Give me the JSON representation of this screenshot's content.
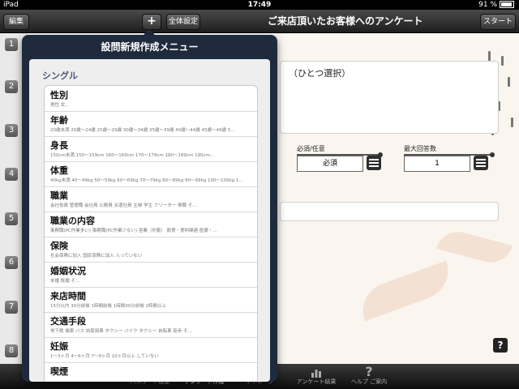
{
  "status": {
    "device": "iPad",
    "time": "17:49",
    "battery": "91 %"
  },
  "nav": {
    "edit": "編集",
    "plus": "+",
    "settings": "全体設定",
    "title": "ご来店頂いたお客様へのアンケート",
    "start": "スタート"
  },
  "questions": {
    "numbers": [
      "1",
      "2",
      "3",
      "4",
      "5",
      "6",
      "7",
      "8"
    ]
  },
  "detail": {
    "question_suffix": "（ひとつ選択）",
    "required_label": "必須/任意",
    "required_value": "必須",
    "max_label": "最大回答数",
    "max_value": "1"
  },
  "popover": {
    "title": "設問新規作成メニュー",
    "section": "シングル",
    "items": [
      {
        "title": "性別",
        "desc": "男性 女..."
      },
      {
        "title": "年齢",
        "desc": "20歳未満 20歳〜24歳 25歳〜29歳 30歳〜34歳 35歳〜39歳 40歳〜44歳 45歳〜49歳 5..."
      },
      {
        "title": "身長",
        "desc": "150cm未満 150〜159cm 160〜169cm 170〜179cm 180〜189cm 190cm..."
      },
      {
        "title": "体重",
        "desc": "40kg未満 40〜49kg 50〜59kg 60〜69kg 70〜79kg 80〜89kg 90〜99kg 100〜109kg 1..."
      },
      {
        "title": "職業",
        "desc": "会社役員 管理職 会社員 公務員 派遣社員 主婦 学生 フリーター 無職 そ..."
      },
      {
        "title": "職業の内容",
        "desc": "事務職(PC作業多い) 事務職(PC作業少ない) 営業（外勤） 飲食・食料関連 医療・..."
      },
      {
        "title": "保険",
        "desc": "社会保険に加入 国民保険に加入 入っていない"
      },
      {
        "title": "婚姻状況",
        "desc": "未婚 既婚 そ..."
      },
      {
        "title": "来店時間",
        "desc": "15分以内 30分前後 1時間前後 1時間30分前後 2時間以上"
      },
      {
        "title": "交通手段",
        "desc": "地下鉄 電車 バス 自家用車 タクシー バイク タクシー 自転車 徒歩 そ..."
      },
      {
        "title": "妊娠",
        "desc": "1〜3ヶ月 4〜6ヶ月 7〜9ヶ月 10ヶ月以上 していない"
      },
      {
        "title": "喫煙",
        "desc": ""
      }
    ]
  },
  "tabs": [
    {
      "label": "パスワード設定",
      "icon": "lock-icon"
    },
    {
      "label": "アンケート作成",
      "icon": "edit-icon"
    },
    {
      "label": "サイネージ",
      "icon": "signage-icon"
    },
    {
      "label": "アンケート結果",
      "icon": "chart-icon"
    },
    {
      "label": "ヘルプ ご案内",
      "icon": "help-icon"
    }
  ]
}
